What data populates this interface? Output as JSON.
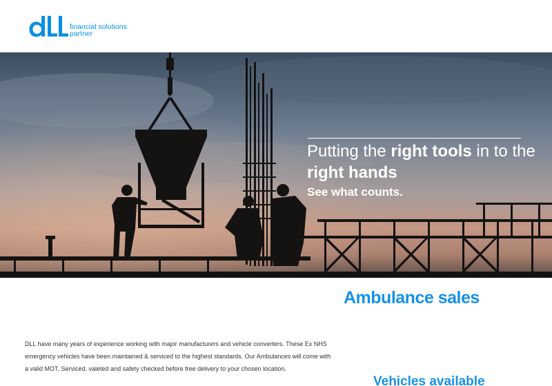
{
  "brand": {
    "logo_letters": "dLL",
    "tagline_line1": "financial solutions",
    "tagline_line2": "partner",
    "color": "#0a8fe4"
  },
  "hero": {
    "headline_part1": "Putting the ",
    "headline_bold1": "right tools",
    "headline_part2": " in to the ",
    "headline_bold2": "right hands",
    "subheadline": "See what counts."
  },
  "content": {
    "title": "Ambulance sales",
    "intro": "DLL have many years of experience working with major manufacturers and vehicle converters. These Ex NHS emergency vehicles have been maintained & serviced to the highest standards. Our Ambulances will come with a valid MOT, Serviced, valeted and safety checked before free delivery to your chosen location.",
    "subheading": "Vehicles available",
    "accent_color": "#1592e6"
  },
  "icons": [
    "dll-logo-icon"
  ]
}
